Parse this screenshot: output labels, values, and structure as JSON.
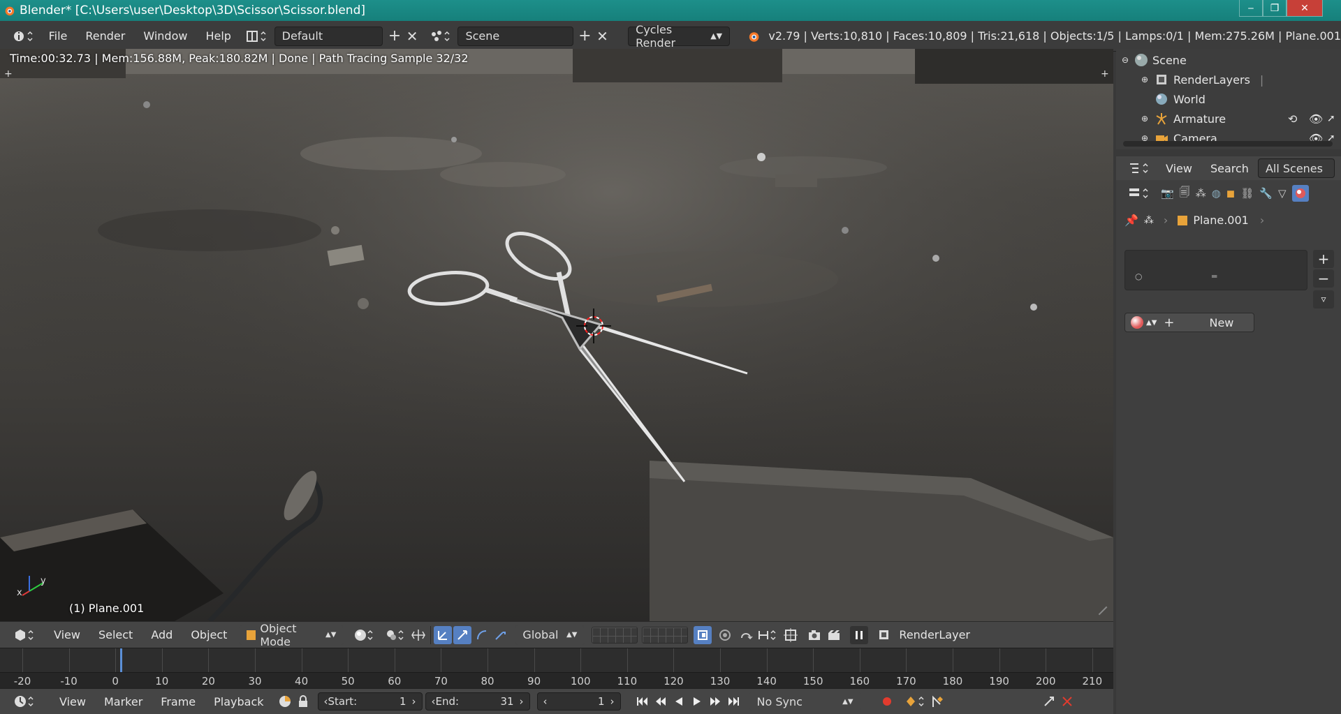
{
  "window": {
    "title": "Blender* [C:\\Users\\user\\Desktop\\3D\\Scissor\\Scissor.blend]",
    "min_label": "‒",
    "max_label": "❐",
    "close_label": "✕"
  },
  "info_header": {
    "menus": [
      "File",
      "Render",
      "Window",
      "Help"
    ],
    "layout": "Default",
    "scene": "Scene",
    "engine": "Cycles Render",
    "stats": "v2.79 | Verts:10,810 | Faces:10,809 | Tris:21,618 | Objects:1/5 | Lamps:0/1 | Mem:275.26M | Plane.001"
  },
  "viewport": {
    "render_info": "Time:00:32.73 | Mem:156.88M, Peak:180.82M | Done | Path Tracing Sample 32/32",
    "object_label": "(1) Plane.001",
    "axis_y": "y",
    "axis_x": "x"
  },
  "viewport_header": {
    "menus": [
      "View",
      "Select",
      "Add",
      "Object"
    ],
    "mode": "Object Mode",
    "orientation": "Global",
    "render_layer": "RenderLayer"
  },
  "timeline": {
    "ticks": [
      -20,
      -10,
      0,
      10,
      20,
      30,
      40,
      50,
      60,
      70,
      80,
      90,
      100,
      110,
      120,
      130,
      140,
      150,
      160,
      170,
      180,
      190,
      200,
      210
    ],
    "current_frame": 1
  },
  "timeline_header": {
    "menus": [
      "View",
      "Marker",
      "Frame",
      "Playback"
    ],
    "start_label": "Start:",
    "start_value": "1",
    "end_label": "End:",
    "end_value": "31",
    "current_frame": "1",
    "sync": "No Sync"
  },
  "outliner": {
    "items": [
      {
        "label": "Scene",
        "icon": "scene-icon"
      },
      {
        "label": "RenderLayers",
        "icon": "render-layers-icon"
      },
      {
        "label": "World",
        "icon": "world-icon"
      },
      {
        "label": "Armature",
        "icon": "armature-icon"
      },
      {
        "label": "Camera",
        "icon": "camera-icon"
      }
    ],
    "header": {
      "view": "View",
      "search": "Search",
      "scope": "All Scenes"
    }
  },
  "properties": {
    "breadcrumb_object": "Plane.001",
    "new_label": "New"
  },
  "colors": {
    "accent": "#5680c2",
    "titlebar": "#1a8a85",
    "playhead": "#5b8fd6",
    "record": "#e23b2e"
  }
}
